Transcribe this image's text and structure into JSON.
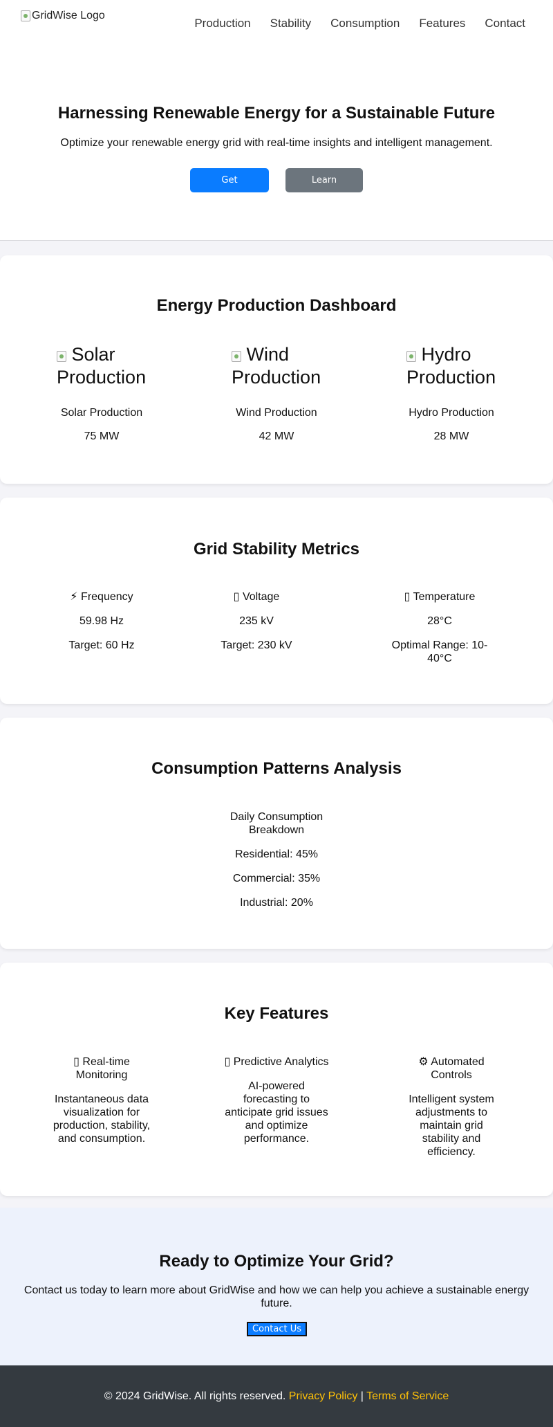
{
  "header": {
    "logo_alt": "GridWise Logo",
    "nav": [
      "Production",
      "Stability",
      "Consumption",
      "Features",
      "Contact"
    ]
  },
  "hero": {
    "title": "Harnessing Renewable Energy for a Sustainable Future",
    "subtitle": "Optimize your renewable energy grid with real-time insights and intelligent management.",
    "primary_button": "Get Started",
    "secondary_button": "Learn More"
  },
  "production": {
    "title": "Energy Production Dashboard",
    "items": [
      {
        "img_alt_1": "Solar",
        "img_alt_2": "Production",
        "label": "Solar Production",
        "value": "75 MW"
      },
      {
        "img_alt_1": "Wind",
        "img_alt_2": "Production",
        "label": "Wind Production",
        "value": "42 MW"
      },
      {
        "img_alt_1": "Hydro",
        "img_alt_2": "Production",
        "label": "Hydro Production",
        "value": "28 MW"
      }
    ]
  },
  "stability": {
    "title": "Grid Stability Metrics",
    "items": [
      {
        "icon": "⚡",
        "name": "Frequency",
        "value": "59.98 Hz",
        "target": "Target: 60 Hz"
      },
      {
        "icon": "▯",
        "name": "Voltage",
        "value": "235 kV",
        "target": "Target: 230 kV"
      },
      {
        "icon": "▯",
        "name": "Temperature",
        "value": "28°C",
        "target_1": "Optimal Range: 10-",
        "target_2": "40°C"
      }
    ]
  },
  "consumption": {
    "title": "Consumption Patterns Analysis",
    "breakdown_title_1": "Daily Consumption",
    "breakdown_title_2": "Breakdown",
    "items": [
      "Residential: 45%",
      "Commercial: 35%",
      "Industrial: 20%"
    ]
  },
  "features": {
    "title": "Key Features",
    "items": [
      {
        "icon": "▯",
        "title_1": "Real-time",
        "title_2": "Monitoring",
        "desc": [
          "Instantaneous data",
          "visualization for",
          "production, stability,",
          "and consumption."
        ]
      },
      {
        "icon": "▯",
        "title_1": "Predictive Analytics",
        "title_2": "",
        "desc": [
          "AI-powered",
          "forecasting to",
          "anticipate grid issues",
          "and optimize",
          "performance."
        ]
      },
      {
        "icon": "⚙",
        "title_1": "Automated",
        "title_2": "Controls",
        "desc": [
          "Intelligent system",
          "adjustments to",
          "maintain grid",
          "stability and",
          "efficiency."
        ]
      }
    ]
  },
  "cta": {
    "title": "Ready to Optimize Your Grid?",
    "text": "Contact us today to learn more about GridWise and how we can help you achieve a sustainable energy future.",
    "button": "Contact Us"
  },
  "footer": {
    "copyright": "© 2024 GridWise. All rights reserved.",
    "privacy": "Privacy Policy",
    "separator": "|",
    "terms": "Terms of Service"
  },
  "colors": {
    "primary": "#0a7cff",
    "secondary": "#6c757d",
    "footer_bg": "#343a40",
    "footer_link": "#ffc107",
    "cta_bg": "#edf2fc"
  }
}
